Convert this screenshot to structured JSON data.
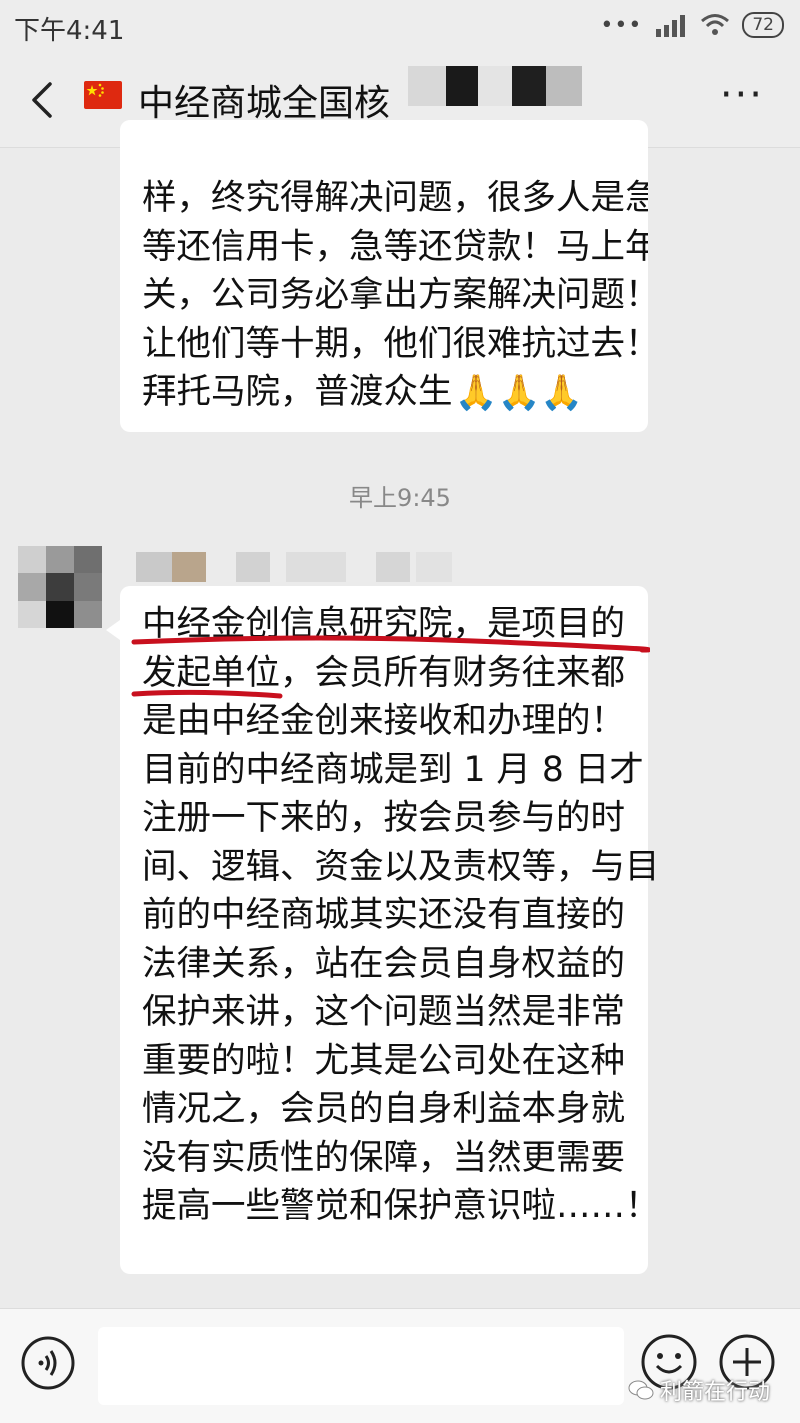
{
  "status_bar": {
    "time": "下午4:41",
    "battery": "72",
    "signal_dots": "•••"
  },
  "header": {
    "title": "中经商城全国核",
    "more": "···"
  },
  "messages": {
    "first": {
      "lines": [
        "样，终究得解决问题，很多人是急",
        "等还信用卡，急等还贷款！马上年",
        "关，公司务必拿出方案解决问题！",
        "让他们等十期，他们很难抗过去！",
        "拜托马院，普渡众生"
      ],
      "emoji": "🙏🙏🙏"
    },
    "timestamp": "早上9:45",
    "second": {
      "lines": [
        "中经金创信息研究院，是项目的",
        "发起单位，会员所有财务往来都",
        "是由中经金创来接收和办理的！",
        "目前的中经商城是到 1 月 8 日才",
        "注册一下来的，按会员参与的时",
        "间、逻辑、资金以及责权等，与目",
        "前的中经商城其实还没有直接的",
        "法律关系，站在会员自身权益的",
        "保护来讲，这个问题当然是非常",
        "重要的啦！尤其是公司处在这种",
        "情况之，会员的自身利益本身就",
        "没有实质性的保障，当然更需要",
        "提高一些警觉和保护意识啦……！"
      ]
    }
  },
  "watermark": "利箭在行动",
  "colors": {
    "background": "#ebebeb",
    "bubble": "#ffffff",
    "underline": "#c8101e"
  }
}
